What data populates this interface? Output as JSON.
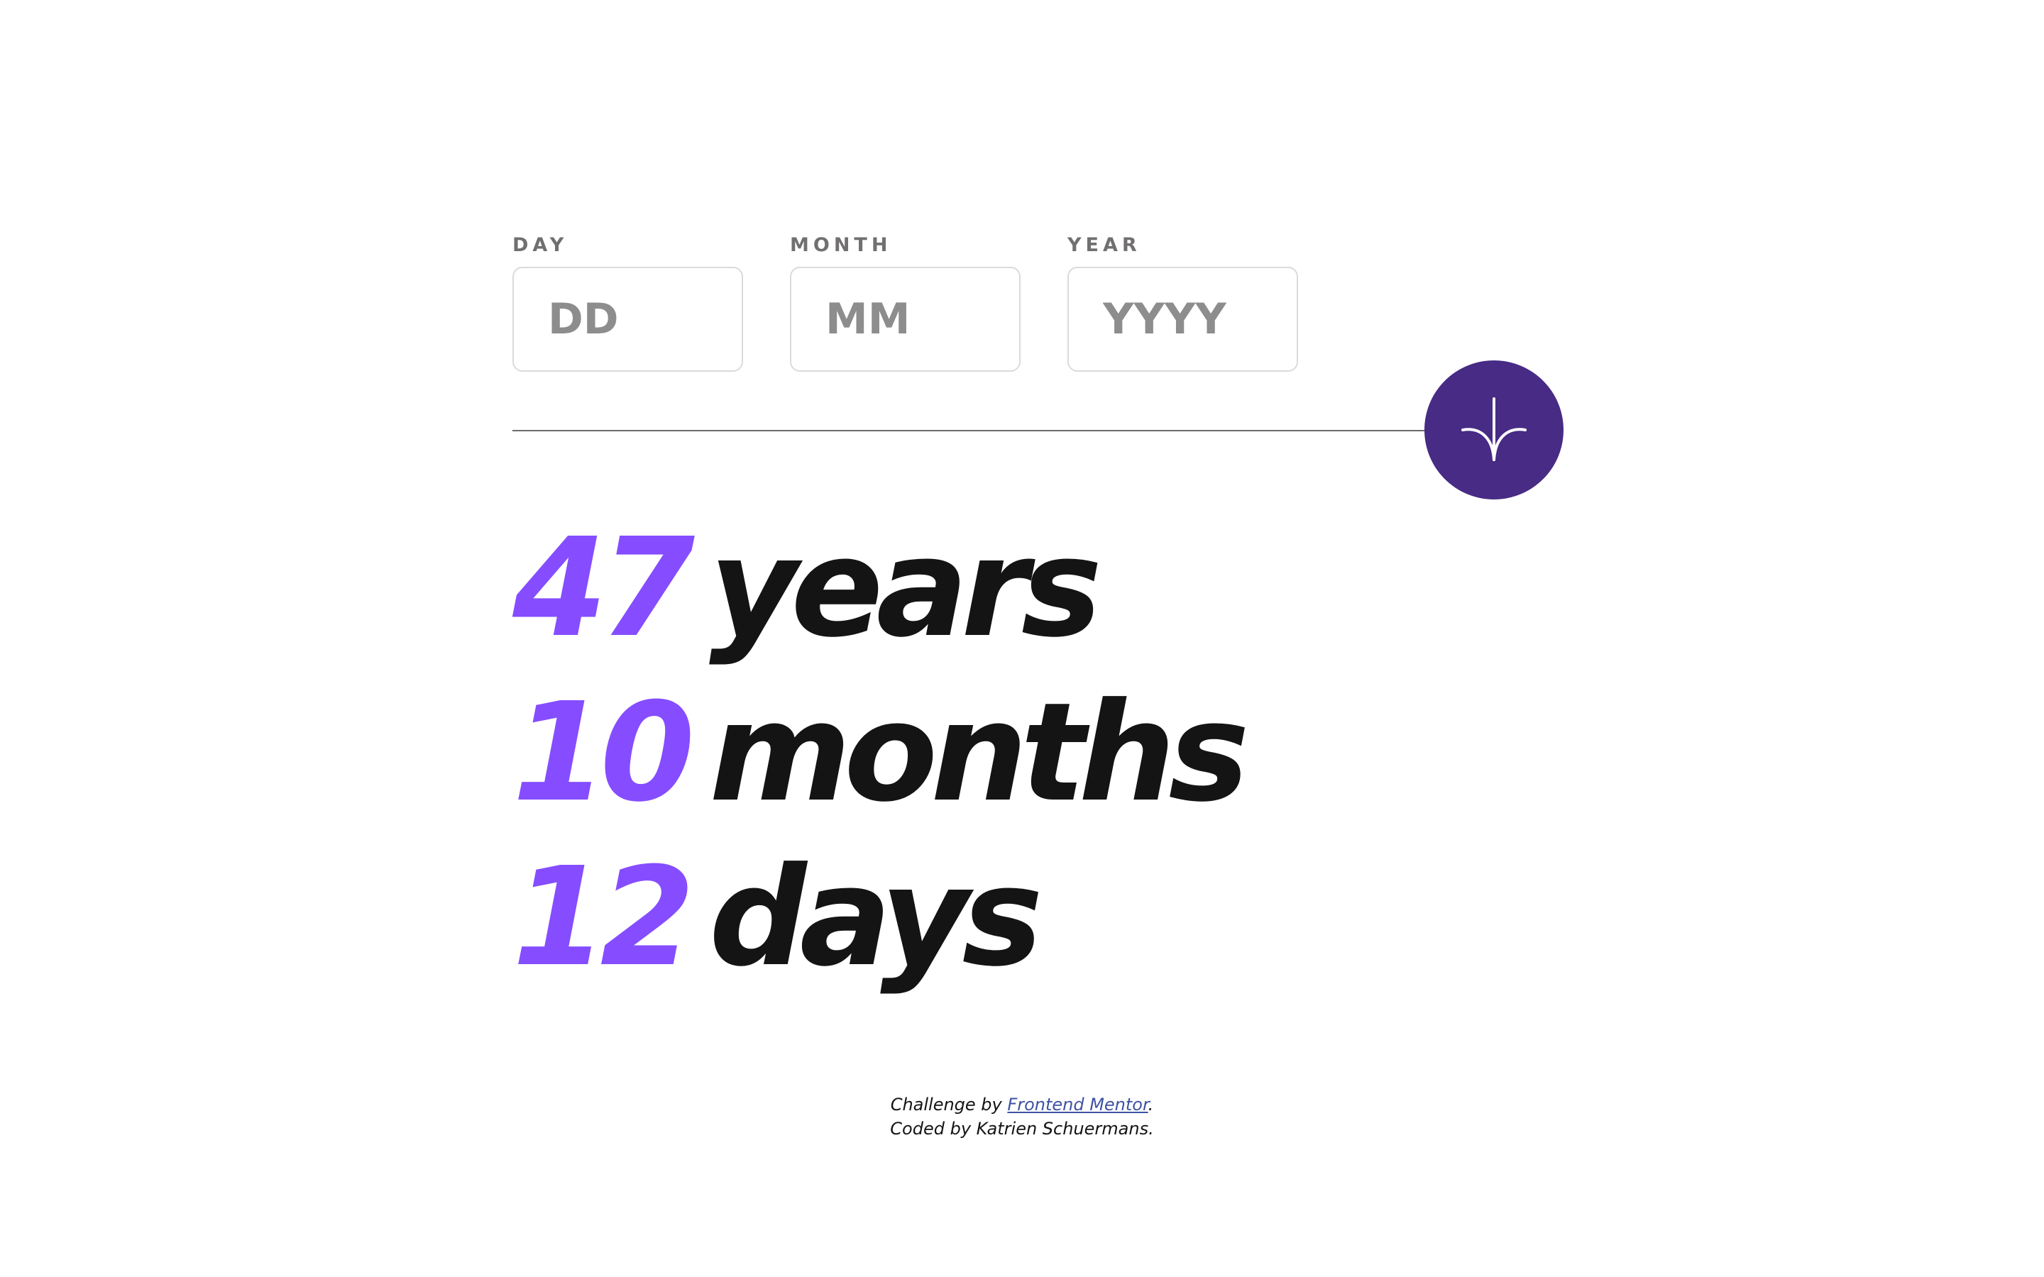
{
  "form": {
    "day": {
      "label": "DAY",
      "placeholder": "DD",
      "value": ""
    },
    "month": {
      "label": "MONTH",
      "placeholder": "MM",
      "value": ""
    },
    "year": {
      "label": "YEAR",
      "placeholder": "YYYY",
      "value": ""
    },
    "submit_icon": "arrow-down-icon"
  },
  "results": {
    "years": {
      "value": "47",
      "unit": "years"
    },
    "months": {
      "value": "10",
      "unit": "months"
    },
    "days": {
      "value": "12",
      "unit": "days"
    }
  },
  "attribution": {
    "challenge_prefix": "Challenge by",
    "link_text": "Frontend Mentor",
    "period": ".",
    "coded_by": "Coded by Katrien Schuermans."
  },
  "colors": {
    "accent": "#854dff",
    "button": "#472b85",
    "text": "#141414",
    "label": "#716f6f",
    "border": "#dbdbdb"
  }
}
